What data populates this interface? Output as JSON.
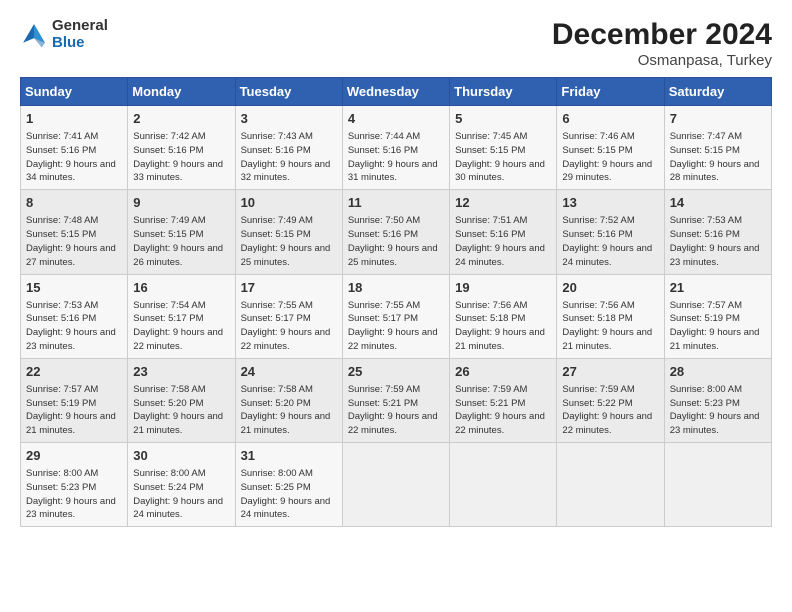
{
  "logo": {
    "line1": "General",
    "line2": "Blue"
  },
  "title": "December 2024",
  "subtitle": "Osmanpasa, Turkey",
  "days_header": [
    "Sunday",
    "Monday",
    "Tuesday",
    "Wednesday",
    "Thursday",
    "Friday",
    "Saturday"
  ],
  "weeks": [
    [
      {
        "num": "1",
        "sunrise": "7:41 AM",
        "sunset": "5:16 PM",
        "daylight": "9 hours and 34 minutes."
      },
      {
        "num": "2",
        "sunrise": "7:42 AM",
        "sunset": "5:16 PM",
        "daylight": "9 hours and 33 minutes."
      },
      {
        "num": "3",
        "sunrise": "7:43 AM",
        "sunset": "5:16 PM",
        "daylight": "9 hours and 32 minutes."
      },
      {
        "num": "4",
        "sunrise": "7:44 AM",
        "sunset": "5:16 PM",
        "daylight": "9 hours and 31 minutes."
      },
      {
        "num": "5",
        "sunrise": "7:45 AM",
        "sunset": "5:15 PM",
        "daylight": "9 hours and 30 minutes."
      },
      {
        "num": "6",
        "sunrise": "7:46 AM",
        "sunset": "5:15 PM",
        "daylight": "9 hours and 29 minutes."
      },
      {
        "num": "7",
        "sunrise": "7:47 AM",
        "sunset": "5:15 PM",
        "daylight": "9 hours and 28 minutes."
      }
    ],
    [
      {
        "num": "8",
        "sunrise": "7:48 AM",
        "sunset": "5:15 PM",
        "daylight": "9 hours and 27 minutes."
      },
      {
        "num": "9",
        "sunrise": "7:49 AM",
        "sunset": "5:15 PM",
        "daylight": "9 hours and 26 minutes."
      },
      {
        "num": "10",
        "sunrise": "7:49 AM",
        "sunset": "5:15 PM",
        "daylight": "9 hours and 25 minutes."
      },
      {
        "num": "11",
        "sunrise": "7:50 AM",
        "sunset": "5:16 PM",
        "daylight": "9 hours and 25 minutes."
      },
      {
        "num": "12",
        "sunrise": "7:51 AM",
        "sunset": "5:16 PM",
        "daylight": "9 hours and 24 minutes."
      },
      {
        "num": "13",
        "sunrise": "7:52 AM",
        "sunset": "5:16 PM",
        "daylight": "9 hours and 24 minutes."
      },
      {
        "num": "14",
        "sunrise": "7:53 AM",
        "sunset": "5:16 PM",
        "daylight": "9 hours and 23 minutes."
      }
    ],
    [
      {
        "num": "15",
        "sunrise": "7:53 AM",
        "sunset": "5:16 PM",
        "daylight": "9 hours and 23 minutes."
      },
      {
        "num": "16",
        "sunrise": "7:54 AM",
        "sunset": "5:17 PM",
        "daylight": "9 hours and 22 minutes."
      },
      {
        "num": "17",
        "sunrise": "7:55 AM",
        "sunset": "5:17 PM",
        "daylight": "9 hours and 22 minutes."
      },
      {
        "num": "18",
        "sunrise": "7:55 AM",
        "sunset": "5:17 PM",
        "daylight": "9 hours and 22 minutes."
      },
      {
        "num": "19",
        "sunrise": "7:56 AM",
        "sunset": "5:18 PM",
        "daylight": "9 hours and 21 minutes."
      },
      {
        "num": "20",
        "sunrise": "7:56 AM",
        "sunset": "5:18 PM",
        "daylight": "9 hours and 21 minutes."
      },
      {
        "num": "21",
        "sunrise": "7:57 AM",
        "sunset": "5:19 PM",
        "daylight": "9 hours and 21 minutes."
      }
    ],
    [
      {
        "num": "22",
        "sunrise": "7:57 AM",
        "sunset": "5:19 PM",
        "daylight": "9 hours and 21 minutes."
      },
      {
        "num": "23",
        "sunrise": "7:58 AM",
        "sunset": "5:20 PM",
        "daylight": "9 hours and 21 minutes."
      },
      {
        "num": "24",
        "sunrise": "7:58 AM",
        "sunset": "5:20 PM",
        "daylight": "9 hours and 21 minutes."
      },
      {
        "num": "25",
        "sunrise": "7:59 AM",
        "sunset": "5:21 PM",
        "daylight": "9 hours and 22 minutes."
      },
      {
        "num": "26",
        "sunrise": "7:59 AM",
        "sunset": "5:21 PM",
        "daylight": "9 hours and 22 minutes."
      },
      {
        "num": "27",
        "sunrise": "7:59 AM",
        "sunset": "5:22 PM",
        "daylight": "9 hours and 22 minutes."
      },
      {
        "num": "28",
        "sunrise": "8:00 AM",
        "sunset": "5:23 PM",
        "daylight": "9 hours and 23 minutes."
      }
    ],
    [
      {
        "num": "29",
        "sunrise": "8:00 AM",
        "sunset": "5:23 PM",
        "daylight": "9 hours and 23 minutes."
      },
      {
        "num": "30",
        "sunrise": "8:00 AM",
        "sunset": "5:24 PM",
        "daylight": "9 hours and 24 minutes."
      },
      {
        "num": "31",
        "sunrise": "8:00 AM",
        "sunset": "5:25 PM",
        "daylight": "9 hours and 24 minutes."
      },
      null,
      null,
      null,
      null
    ]
  ],
  "labels": {
    "sunrise_prefix": "Sunrise: ",
    "sunset_prefix": "Sunset: ",
    "daylight_prefix": "Daylight: "
  }
}
